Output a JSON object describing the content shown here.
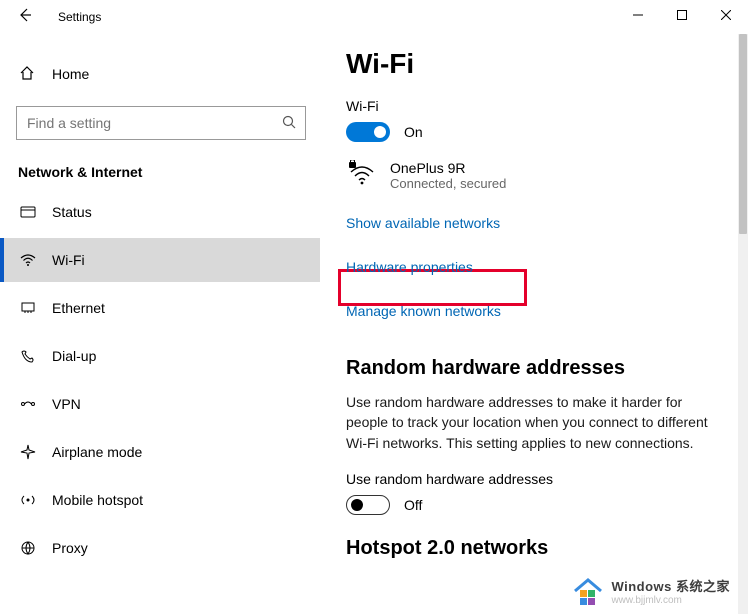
{
  "app_title": "Settings",
  "sidebar": {
    "home": "Home",
    "search_placeholder": "Find a setting",
    "section": "Network & Internet",
    "items": [
      {
        "label": "Status"
      },
      {
        "label": "Wi-Fi"
      },
      {
        "label": "Ethernet"
      },
      {
        "label": "Dial-up"
      },
      {
        "label": "VPN"
      },
      {
        "label": "Airplane mode"
      },
      {
        "label": "Mobile hotspot"
      },
      {
        "label": "Proxy"
      }
    ]
  },
  "main": {
    "page_title": "Wi-Fi",
    "wifi_label": "Wi-Fi",
    "wifi_toggle_state": "On",
    "network_name": "OnePlus 9R",
    "network_status": "Connected, secured",
    "link_available": "Show available networks",
    "link_hwprops": "Hardware properties",
    "link_manage": "Manage known networks",
    "random_heading": "Random hardware addresses",
    "random_text": "Use random hardware addresses to make it harder for people to track your location when you connect to different Wi-Fi networks. This setting applies to new connections.",
    "random_label": "Use random hardware addresses",
    "random_toggle_state": "Off",
    "hotspot_heading": "Hotspot 2.0 networks"
  },
  "watermark": {
    "line1": "Windows 系统之家",
    "line2": "www.bjjmlv.com"
  }
}
